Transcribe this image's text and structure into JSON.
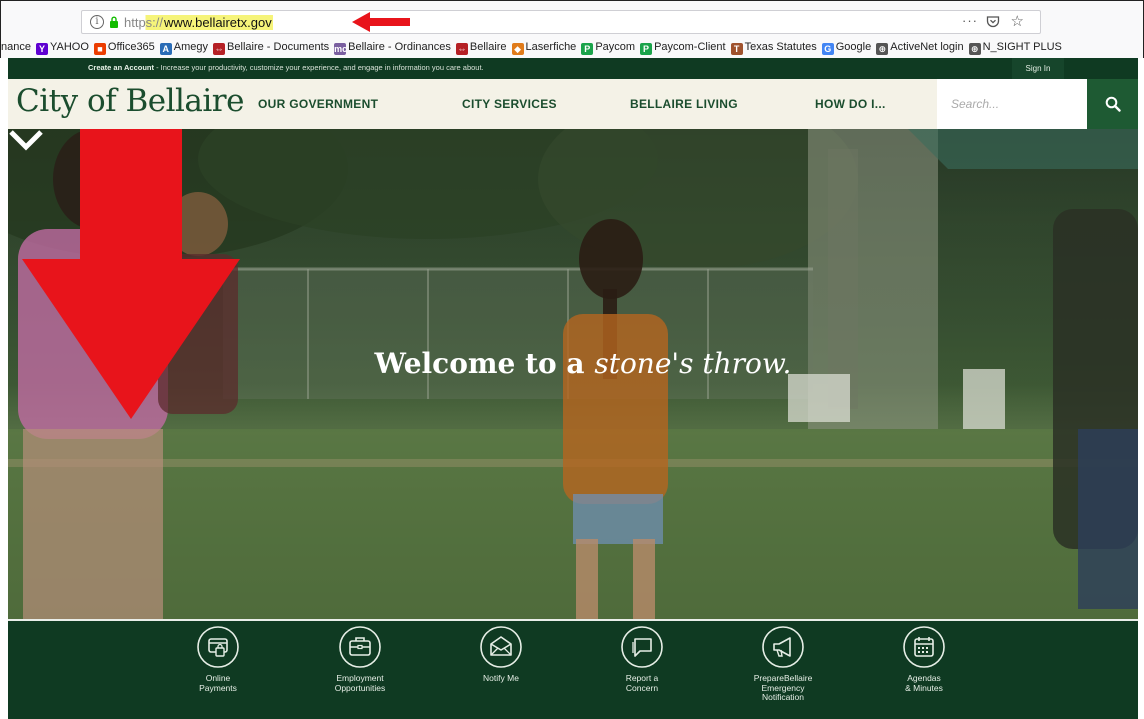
{
  "browser": {
    "url_prefix": "https://",
    "url_host": "www.bellairetx.gov",
    "url_more": "···",
    "bookmarks": [
      {
        "label": "nance",
        "icon": "none"
      },
      {
        "label": "YAHOO",
        "icon": "yahoo-icon",
        "color": "#5f01d1",
        "glyph": "Y"
      },
      {
        "label": "Office365",
        "icon": "office-icon",
        "color": "#eb3c00",
        "glyph": "■"
      },
      {
        "label": "Amegy",
        "icon": "amegy-icon",
        "color": "#2a6cb6",
        "glyph": "A"
      },
      {
        "label": "Bellaire - Documents",
        "icon": "bellaire-icon",
        "color": "#b52025",
        "glyph": "⇔"
      },
      {
        "label": "Bellaire - Ordinances",
        "icon": "municode-icon",
        "color": "#7a5fa0",
        "glyph": "mc"
      },
      {
        "label": "Bellaire",
        "icon": "bellaire-icon",
        "color": "#b52025",
        "glyph": "⇔"
      },
      {
        "label": "Laserfiche",
        "icon": "laserfiche-icon",
        "color": "#e07b1a",
        "glyph": "◆"
      },
      {
        "label": "Paycom",
        "icon": "paycom-icon",
        "color": "#1aa34a",
        "glyph": "P"
      },
      {
        "label": "Paycom-Client",
        "icon": "paycom-icon",
        "color": "#1aa34a",
        "glyph": "P"
      },
      {
        "label": "Texas Statutes",
        "icon": "texas-icon",
        "color": "#a0522d",
        "glyph": "T"
      },
      {
        "label": "Google",
        "icon": "google-icon",
        "color": "#4285f4",
        "glyph": "G"
      },
      {
        "label": "ActiveNet login",
        "icon": "globe-icon",
        "color": "#555555",
        "glyph": "⊕"
      },
      {
        "label": "N_SIGHT PLUS",
        "icon": "globe-icon",
        "color": "#555555",
        "glyph": "⊕"
      }
    ]
  },
  "site": {
    "topstrip_bold": "Create an Account",
    "topstrip_text": " - Increase your productivity, customize your experience, and engage in information you care about.",
    "signin": "Sign In",
    "logo": "City of Bellaire",
    "nav": [
      "OUR GOVERNMENT",
      "CITY SERVICES",
      "BELLAIRE LIVING",
      "HOW DO I..."
    ],
    "search_placeholder": "Search...",
    "accent_green": "#0f3a22",
    "header_bg": "#f4f2e7",
    "hero_title_main": "Welcome to a ",
    "hero_title_italic": "stone's throw."
  },
  "quicklinks": [
    {
      "label": "Online\nPayments",
      "icon": "payment-card-icon"
    },
    {
      "label": "Employment\nOpportunities",
      "icon": "briefcase-icon"
    },
    {
      "label": "Notify Me",
      "icon": "envelope-icon"
    },
    {
      "label": "Report a\nConcern",
      "icon": "chat-icon"
    },
    {
      "label": "PrepareBellaire\nEmergency\nNotification",
      "icon": "megaphone-icon"
    },
    {
      "label": "Agendas\n& Minutes",
      "icon": "calendar-icon"
    }
  ]
}
